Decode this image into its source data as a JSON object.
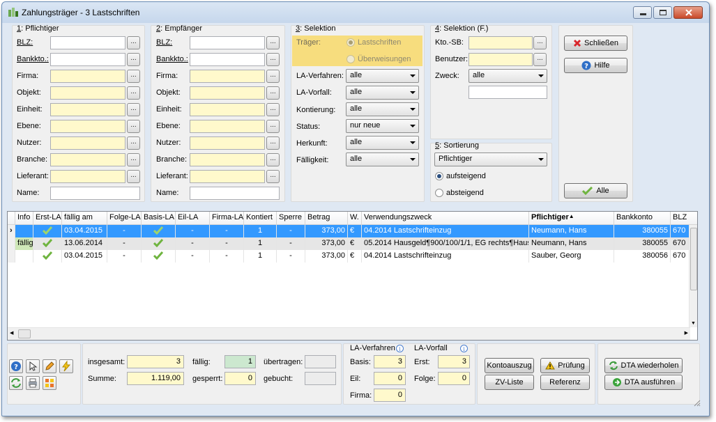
{
  "window": {
    "title": "Zahlungsträger - 3 Lastschriften"
  },
  "groups": {
    "pflichtiger": {
      "number": "1",
      "title": ": Pflichtiger"
    },
    "empfaenger": {
      "number": "2",
      "title": ": Empfänger"
    },
    "selektion": {
      "number": "3",
      "title": ": Selektion"
    },
    "selektion_f": {
      "number": "4",
      "title": ": Selektion (F.)"
    },
    "sortierung": {
      "number": "5",
      "title": ": Sortierung"
    }
  },
  "labels": {
    "blz": "BLZ:",
    "bankkto": "Bankkto.:",
    "firma": "Firma:",
    "objekt": "Objekt:",
    "einheit": "Einheit:",
    "ebene": "Ebene:",
    "nutzer": "Nutzer:",
    "branche": "Branche:",
    "lieferant": "Lieferant:",
    "name": "Name:",
    "dots": "..."
  },
  "selektion": {
    "traeger_label": "Träger:",
    "lastschriften": "Lastschriften",
    "ueberweisungen": "Überweisungen",
    "fields": [
      {
        "label": "LA-Verfahren:",
        "value": "alle"
      },
      {
        "label": "LA-Vorfall:",
        "value": "alle"
      },
      {
        "label": "Kontierung:",
        "value": "alle"
      },
      {
        "label": "Status:",
        "value": "nur neue"
      },
      {
        "label": "Herkunft:",
        "value": "alle"
      },
      {
        "label": "Fälligkeit:",
        "value": "alle"
      }
    ]
  },
  "selektion_f": {
    "kto_sb": "Kto.-SB:",
    "benutzer": "Benutzer:",
    "zweck": "Zweck:",
    "zweck_value": "alle"
  },
  "sortierung": {
    "value": "Pflichtiger",
    "aufsteigend": "aufsteigend",
    "absteigend": "absteigend"
  },
  "buttons": {
    "schliessen": "Schließen",
    "hilfe": "Hilfe",
    "alle": "Alle",
    "kontoauszug": "Kontoauszug",
    "pruefung": "Prüfung",
    "zv_liste": "ZV-Liste",
    "referenz": "Referenz",
    "dta_wiederholen": "DTA wiederholen",
    "dta_ausfuehren": "DTA ausführen"
  },
  "table": {
    "columns": [
      "Info",
      "Erst-LA",
      "fällig am",
      "Folge-LA",
      "Basis-LA",
      "Eil-LA",
      "Firma-LA",
      "Kontiert",
      "Sperre",
      "Betrag",
      "W.",
      "Verwendungszweck",
      "Pflichtiger",
      "Bankkonto",
      "BLZ"
    ],
    "rows": [
      {
        "info": "",
        "faellig": "03.04.2015",
        "folge": "-",
        "eil": "-",
        "firma": "-",
        "kontiert": "1",
        "sperre": "-",
        "betrag": "373,00",
        "w": "€",
        "zweck": "04.2014 Lastschrifteinzug",
        "pflichtiger": "Neumann, Hans",
        "bankkonto": "380055",
        "blz": "670"
      },
      {
        "info": "fällig",
        "faellig": "13.06.2014",
        "folge": "-",
        "eil": "-",
        "firma": "-",
        "kontiert": "1",
        "sperre": "-",
        "betrag": "373,00",
        "w": "€",
        "zweck": "05.2014 Hausgeld¶900/100/1/1, EG rechts¶Haus",
        "pflichtiger": "Neumann, Hans",
        "bankkonto": "380055",
        "blz": "670"
      },
      {
        "info": "",
        "faellig": "03.04.2015",
        "folge": "-",
        "eil": "-",
        "firma": "-",
        "kontiert": "1",
        "sperre": "-",
        "betrag": "373,00",
        "w": "€",
        "zweck": "04.2014 Lastschrifteinzug",
        "pflichtiger": "Sauber, Georg",
        "bankkonto": "380056",
        "blz": "670"
      }
    ]
  },
  "footer": {
    "insgesamt_label": "insgesamt:",
    "insgesamt": "3",
    "summe_label": "Summe:",
    "summe": "1.119,00",
    "faellig_label": "fällig:",
    "faellig": "1",
    "gesperrt_label": "gesperrt:",
    "gesperrt": "0",
    "uebertragen_label": "übertragen:",
    "gebucht_label": "gebucht:",
    "la_verfahren": "LA-Verfahren",
    "la_vorfall": "LA-Vorfall",
    "basis_label": "Basis:",
    "basis": "3",
    "eil_label": "Eil:",
    "eil": "0",
    "firma_label": "Firma:",
    "firma": "0",
    "erst_label": "Erst:",
    "erst": "3",
    "folge_label": "Folge:",
    "folge": "0"
  },
  "icons": [
    "help-icon",
    "pointer-icon",
    "edit-icon",
    "lightning-icon",
    "refresh-icon",
    "printer-icon",
    "grid-icon",
    "close-x-icon",
    "question-icon",
    "check-icon",
    "warning-icon",
    "info-icon"
  ]
}
